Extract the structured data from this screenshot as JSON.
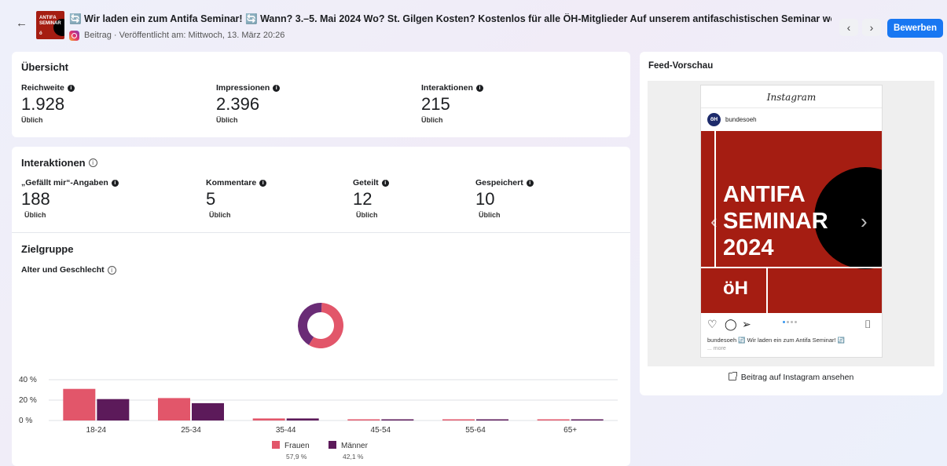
{
  "header": {
    "back_icon": "arrow-left-icon",
    "thumb_line1": "ANTIFA",
    "thumb_line2": "SEMINAR",
    "thumb_logo": "ö",
    "title": "🔄 Wir laden ein zum Antifa Seminar! 🔄 Wann? 3.–5. Mai 2024 Wo? St. Gilgen Kosten? Kostenlos für alle ÖH-Mitglieder Auf unserem antifaschistischen Seminar wollen wir uns ...",
    "subtitle": "Beitrag · Veröffentlicht am: Mittwoch, 13. März 20:26",
    "prev_label": "‹",
    "next_label": "›",
    "promote_label": "Bewerben"
  },
  "overview": {
    "title": "Übersicht",
    "stats": [
      {
        "label": "Reichweite",
        "value": "1.928",
        "sub": "Üblich"
      },
      {
        "label": "Impressionen",
        "value": "2.396",
        "sub": "Üblich"
      },
      {
        "label": "Interaktionen",
        "value": "215",
        "sub": "Üblich"
      }
    ]
  },
  "interactions": {
    "title": "Interaktionen",
    "stats": [
      {
        "label": "„Gefällt mir“-Angaben",
        "value": "188",
        "sub": "Üblich"
      },
      {
        "label": "Kommentare",
        "value": "5",
        "sub": "Üblich"
      },
      {
        "label": "Geteilt",
        "value": "12",
        "sub": "Üblich"
      },
      {
        "label": "Gespeichert",
        "value": "10",
        "sub": "Üblich"
      }
    ]
  },
  "audience": {
    "title": "Zielgruppe",
    "subtitle": "Alter und Geschlecht",
    "legend": [
      {
        "name": "Frauen",
        "pct": "57,9 %",
        "color": "#e2566a"
      },
      {
        "name": "Männer",
        "pct": "42,1 %",
        "color": "#5c1a5a"
      }
    ]
  },
  "chart_data": [
    {
      "type": "pie",
      "labels": [
        "Frauen",
        "Männer"
      ],
      "values": [
        57.9,
        42.1
      ],
      "colors": [
        "#e2566a",
        "#6a2c76"
      ]
    },
    {
      "type": "bar",
      "categories": [
        "18-24",
        "25-34",
        "35-44",
        "45-54",
        "55-64",
        "65+"
      ],
      "series": [
        {
          "name": "Frauen",
          "values": [
            31,
            22,
            2,
            1,
            0.5,
            0.5
          ],
          "color": "#e2566a"
        },
        {
          "name": "Männer",
          "values": [
            21,
            17,
            2,
            1,
            0.5,
            0.5
          ],
          "color": "#5c1a5a"
        }
      ],
      "yticks": [
        "40 %",
        "20 %",
        "0 %"
      ],
      "ylim": [
        0,
        40
      ],
      "grid": true
    }
  ],
  "preview": {
    "title": "Feed-Vorschau",
    "ig_logo": "Instagram",
    "account": "bundesoeh",
    "avatar": "ӧH",
    "post_headline": "ANTIFA\nSEMINAR\n2024",
    "post_logo": "ӧH",
    "caption": "bundesoeh 🔄 Wir laden ein zum Antifa Seminar! 🔄",
    "more": "... more",
    "view_link": "Beitrag auf Instagram ansehen",
    "icons": [
      "heart-icon",
      "comment-icon",
      "share-icon",
      "bookmark-icon"
    ]
  }
}
